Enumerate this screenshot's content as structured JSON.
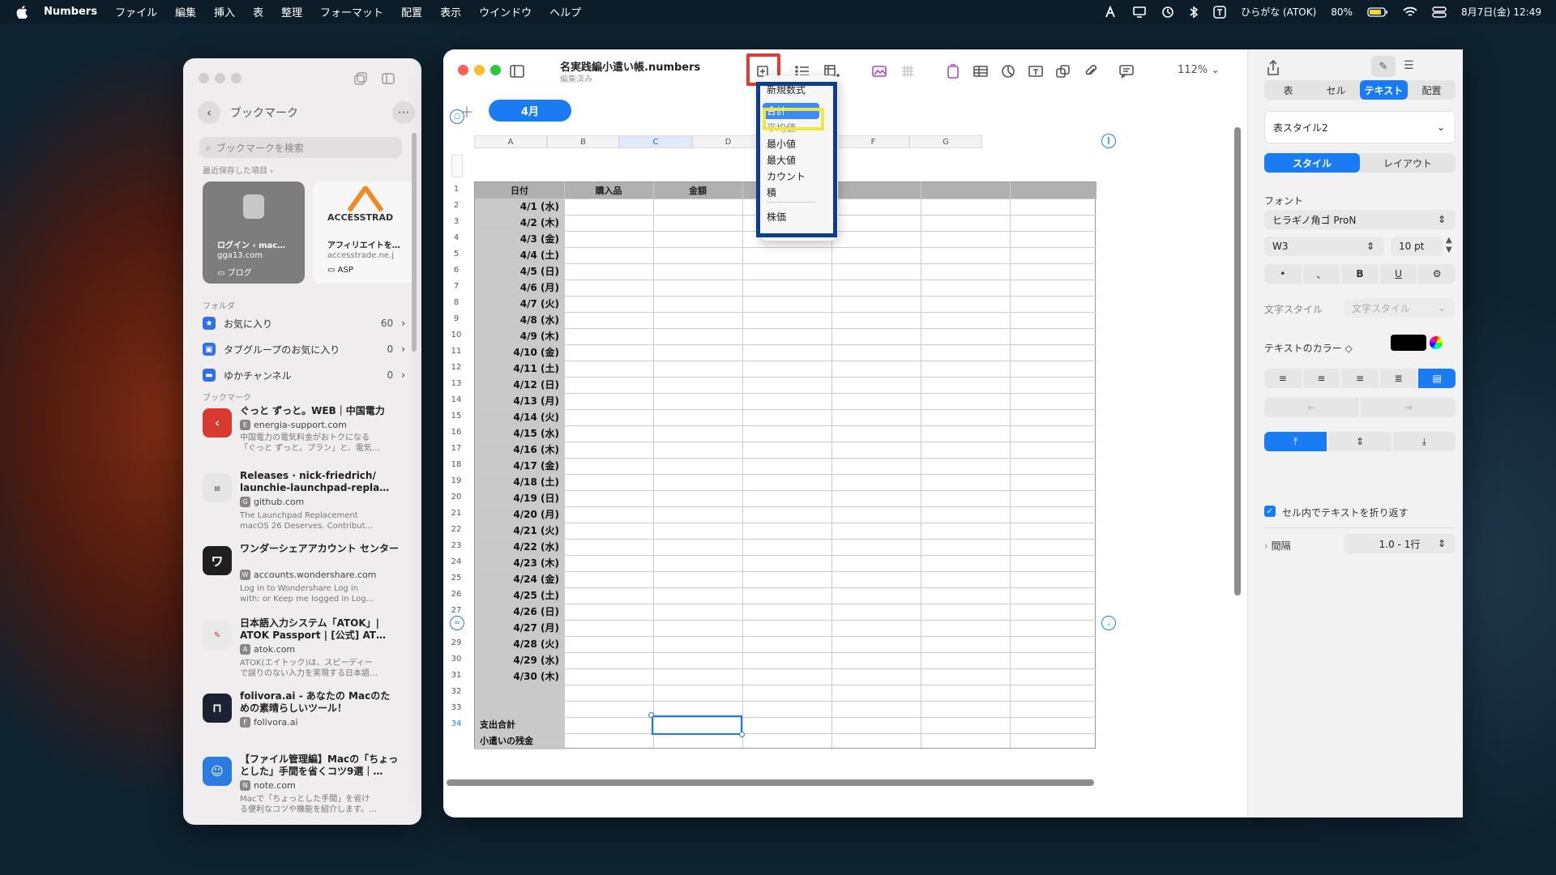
{
  "menubar": {
    "items": [
      "Numbers",
      "ファイル",
      "編集",
      "挿入",
      "表",
      "整理",
      "フォーマット",
      "配置",
      "表示",
      "ウインドウ",
      "ヘルプ"
    ],
    "input_method": "ひらがな (ATOK)",
    "battery": "80%",
    "datetime": "8月7日(金) 12:49"
  },
  "safari": {
    "header_title": "ブックマーク",
    "search_placeholder": "ブックマークを検索",
    "recent_label": "最近保存した項目",
    "cards": [
      {
        "title": "ログイン ‹ mac…",
        "domain": "gga13.com",
        "folder": "ブログ"
      },
      {
        "title": "アフィリエイトを…",
        "domain": "accesstrade.ne.j",
        "folder": "ASP",
        "logo_text": "ACCESSTRAD"
      }
    ],
    "folders_label": "フォルダ",
    "folders": [
      {
        "name": "お気に入り",
        "count": "60"
      },
      {
        "name": "タブグループのお気に入り",
        "count": "0"
      },
      {
        "name": "ゆかチャンネル",
        "count": "0"
      }
    ],
    "bookmarks_label": "ブックマーク",
    "bookmarks": [
      {
        "title": "ぐっと ずっと。WEB｜中国電力",
        "domain": "energia-support.com",
        "badge": "E",
        "desc1": "中国電力の電気料金がおトクになる",
        "desc2": "「ぐっと ずっと。プラン」と、電気…",
        "icon_color": "#d93a30"
      },
      {
        "title": "Releases · nick-friedrich/ launchie-launchpad-repla…",
        "domain": "github.com",
        "badge": "G",
        "desc1": "The Launchpad Replacement",
        "desc2": "macOS 26 Deserves. Contribut…",
        "icon_color": "#e6e6e6"
      },
      {
        "title": "ワンダーシェアアカウント センター",
        "domain": "accounts.wondershare.com",
        "badge": "W",
        "desc1": "Log in to Wondershare Log in",
        "desc2": "with: or Keep me logged in Log…",
        "icon_color": "#1f1f1f",
        "icon_text": "ワ"
      },
      {
        "title": "日本語入力システム「ATOK」| ATOK Passport | [公式] AT…",
        "domain": "atok.com",
        "badge": "A",
        "desc1": "ATOK(エイトック)は、スピーディー",
        "desc2": "で誤りのない入力を実現する日本語…",
        "icon_color": "#e9e9e9"
      },
      {
        "title": "folivora.ai - あなたの Macのた めの素晴らしいツール！",
        "domain": "folivora.ai",
        "badge": "F",
        "desc1": "",
        "desc2": "",
        "icon_color": "#1d2233"
      },
      {
        "title": "【ファイル管理編】Macの「ちょっ とした」手間を省くコツ9選｜…",
        "domain": "note.com",
        "badge": "N",
        "desc1": "Macで「ちょっとした手間」を省け",
        "desc2": "る便利なコツや機能を紹介します。…",
        "icon_color": "#2b7be0"
      }
    ]
  },
  "numbers": {
    "doc_title": "名実践編小遣い帳.numbers",
    "doc_status": "編集済み",
    "zoom": "112%",
    "sheet_tab": "4月",
    "columns": [
      "A",
      "B",
      "C",
      "D",
      "E",
      "F",
      "G"
    ],
    "header_row": {
      "a": "日付",
      "b": "購入品",
      "c": "金額"
    },
    "dates": [
      "4/1 (水)",
      "4/2 (木)",
      "4/3 (金)",
      "4/4 (土)",
      "4/5 (日)",
      "4/6 (月)",
      "4/7 (火)",
      "4/8 (水)",
      "4/9 (木)",
      "4/10 (金)",
      "4/11 (土)",
      "4/12 (日)",
      "4/13 (月)",
      "4/14 (火)",
      "4/15 (水)",
      "4/16 (木)",
      "4/17 (金)",
      "4/18 (土)",
      "4/19 (日)",
      "4/20 (月)",
      "4/21 (火)",
      "4/22 (水)",
      "4/23 (木)",
      "4/24 (金)",
      "4/25 (土)",
      "4/26 (日)",
      "4/27 (月)",
      "4/28 (火)",
      "4/29 (水)",
      "4/30 (木)"
    ],
    "total_label": "支出合計",
    "remaining_label": "小遣いの残金",
    "formula_menu": {
      "items": [
        "新規数式",
        "合計",
        "平均値",
        "最小値",
        "最大値",
        "カウント",
        "積",
        "株価"
      ],
      "highlighted": "合計"
    }
  },
  "inspector": {
    "tabs": [
      "表",
      "セル",
      "テキスト",
      "配置"
    ],
    "active_tab": "テキスト",
    "table_style": "表スタイル2",
    "sub_tabs": [
      "スタイル",
      "レイアウト"
    ],
    "active_sub_tab": "スタイル",
    "font_label": "フォント",
    "font_name": "ヒラギノ角ゴ ProN",
    "font_weight": "W3",
    "font_size": "10 pt",
    "format_buttons": [
      "•",
      "、",
      "B",
      "U"
    ],
    "char_style_label": "文字スタイル",
    "char_style_value": "文字スタイル",
    "text_color_label": "テキストのカラー ◇",
    "text_color": "#000000",
    "wrap_label": "セル内でテキストを折り返す",
    "spacing_label": "間隔",
    "spacing_value": "1.0 - 1行"
  },
  "colors": {
    "accent": "#1a7cf5",
    "red_annotation": "#e53a31",
    "navy_annotation": "#0e3d8c",
    "yellow_annotation": "#f2e83b"
  }
}
